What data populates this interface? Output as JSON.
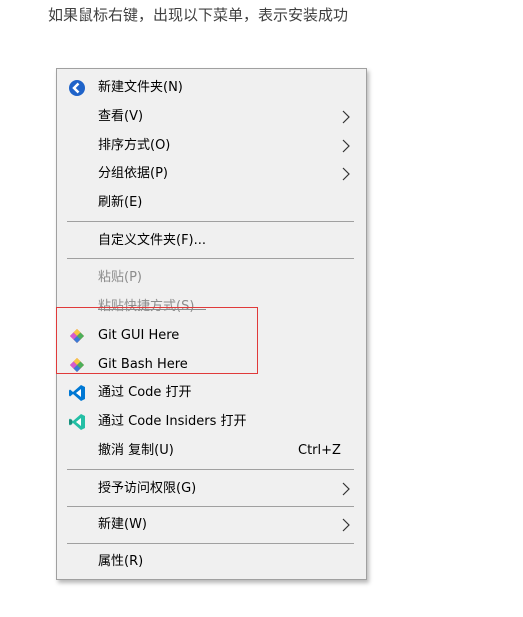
{
  "caption": "如果鼠标右键，出现以下菜单，表示安装成功",
  "menu": {
    "items": [
      {
        "label": "新建文件夹(N)",
        "icon": "new-folder-icon"
      },
      {
        "label": "查看(V)",
        "submenu": true
      },
      {
        "label": "排序方式(O)",
        "submenu": true
      },
      {
        "label": "分组依据(P)",
        "submenu": true
      },
      {
        "label": "刷新(E)"
      },
      {
        "label": "自定义文件夹(F)..."
      },
      {
        "label": "粘贴(P)",
        "disabled": true
      },
      {
        "label": "粘贴快捷方式(S)",
        "disabled": true
      },
      {
        "label": "Git GUI Here",
        "icon": "git-icon"
      },
      {
        "label": "Git Bash Here",
        "icon": "git-icon"
      },
      {
        "label": "通过 Code 打开",
        "icon": "vscode-icon"
      },
      {
        "label": "通过 Code Insiders 打开",
        "icon": "vscode-insiders-icon"
      },
      {
        "label": "撤消 复制(U)",
        "shortcut": "Ctrl+Z"
      },
      {
        "label": "授予访问权限(G)",
        "submenu": true
      },
      {
        "label": "新建(W)",
        "submenu": true
      },
      {
        "label": "属性(R)"
      }
    ]
  },
  "colors": {
    "menu_bg": "#f0f0f0",
    "highlight_border": "#e03a3a",
    "vscode_blue": "#0078d4",
    "vscode_insiders_green": "#24bfa5"
  }
}
